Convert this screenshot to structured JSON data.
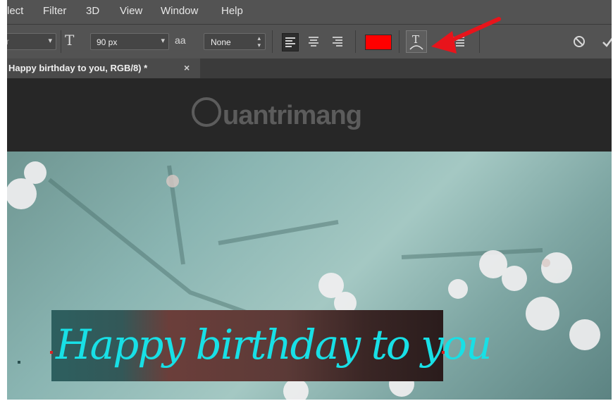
{
  "menu": [
    "lect",
    "Filter",
    "3D",
    "View",
    "Window",
    "Help"
  ],
  "options": {
    "font_size": "90 px",
    "antialias_icon": "aa",
    "antialias": "None",
    "align": [
      "align-left-icon",
      "align-center-icon",
      "align-right-icon"
    ],
    "text_color": "#ff0000"
  },
  "document": {
    "tab_title": "Happy birthday to you, RGB/8) *",
    "close": "×"
  },
  "watermark": "uantrimang",
  "canvas_text": "Happy birthday to you",
  "annotation": {
    "arrow_color": "#e8141b"
  }
}
